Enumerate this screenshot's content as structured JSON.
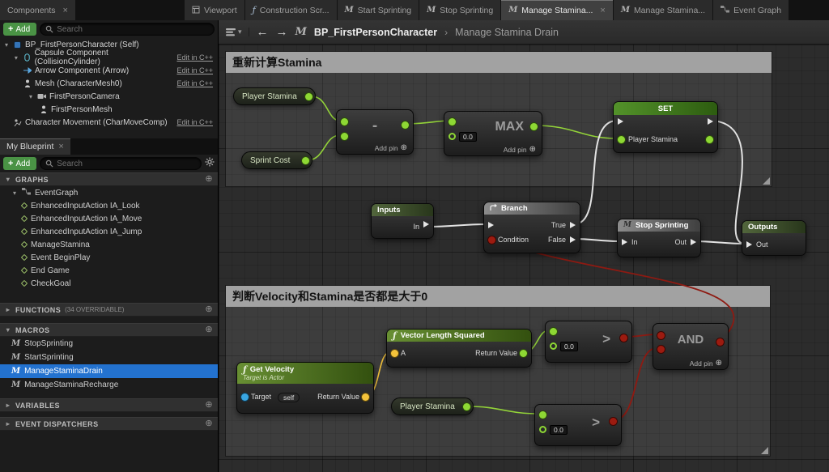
{
  "icons": {
    "close": "×",
    "plus": "+",
    "add_pin_circle": "⊕",
    "caret_down": "▾",
    "caret_right": "▸",
    "back": "←",
    "forward": "→",
    "crumb_sep": "›",
    "dropdown": "▾",
    "macro": "M",
    "function": "ƒ"
  },
  "tab_bar": {
    "components_tab": "Components",
    "tabs": [
      {
        "label": "Viewport"
      },
      {
        "label": "Construction Scr..."
      },
      {
        "label": "Start Sprinting"
      },
      {
        "label": "Stop Sprinting"
      },
      {
        "label": "Manage Stamina..."
      },
      {
        "label": "Manage Stamina..."
      },
      {
        "label": "Event Graph"
      }
    ]
  },
  "toolbar": {
    "breadcrumb_root": "BP_FirstPersonCharacter",
    "breadcrumb_current": "Manage Stamina Drain"
  },
  "components_panel": {
    "add_button": "Add",
    "search_placeholder": "Search",
    "rows": [
      {
        "label": "BP_FirstPersonCharacter (Self)"
      },
      {
        "label": "Capsule Component (CollisionCylinder)",
        "edit": "Edit in C++"
      },
      {
        "label": "Arrow Component (Arrow)",
        "edit": "Edit in C++"
      },
      {
        "label": "Mesh (CharacterMesh0)",
        "edit": "Edit in C++"
      },
      {
        "label": "FirstPersonCamera"
      },
      {
        "label": "FirstPersonMesh"
      },
      {
        "label": "Character Movement (CharMoveComp)",
        "edit": "Edit in C++"
      }
    ]
  },
  "my_blueprint": {
    "title": "My Blueprint",
    "add_button": "Add",
    "search_placeholder": "Search",
    "graphs_header": "GRAPHS",
    "event_graph": "EventGraph",
    "graph_items": [
      "EnhancedInputAction IA_Look",
      "EnhancedInputAction IA_Move",
      "EnhancedInputAction IA_Jump",
      "ManageStamina",
      "Event BeginPlay",
      "End Game",
      "CheckGoal"
    ],
    "functions_header": "FUNCTIONS",
    "functions_note": "(34 OVERRIDABLE)",
    "macros_header": "MACROS",
    "macro_items": [
      {
        "label": "StopSprinting"
      },
      {
        "label": "StartSprinting"
      },
      {
        "label": "ManageStaminaDrain"
      },
      {
        "label": "ManageStaminaRecharge"
      }
    ],
    "variables_header": "VARIABLES",
    "event_dispatchers_header": "EVENT DISPATCHERS"
  },
  "graph": {
    "comment1": "重新计算Stamina",
    "comment2": "判断Velocity和Stamina是否都是大于0",
    "nodes": {
      "player_stamina_a": "Player Stamina",
      "sprint_cost": "Sprint Cost",
      "subtract": {
        "symbol": "-",
        "add_pin": "Add pin"
      },
      "max": {
        "title": "MAX",
        "literal": "0.0",
        "add_pin": "Add pin"
      },
      "set": {
        "header": "SET",
        "var_name": "Player Stamina"
      },
      "inputs": {
        "title": "Inputs",
        "out_pin": "In"
      },
      "branch": {
        "title": "Branch",
        "condition": "Condition",
        "true_pin": "True",
        "false_pin": "False"
      },
      "stop_sprinting": {
        "title": "Stop Sprinting",
        "in_pin": "In",
        "out_pin": "Out"
      },
      "outputs": {
        "title": "Outputs",
        "in_pin": "Out"
      },
      "get_velocity": {
        "title": "Get Velocity",
        "subtitle": "Target is Actor",
        "target_label": "Target",
        "target_value": "self",
        "return_label": "Return Value"
      },
      "vector_length_squared": {
        "title": "Vector Length Squared",
        "a_label": "A",
        "return_label": "Return Value"
      },
      "greater_a": {
        "symbol": ">",
        "literal": "0.0"
      },
      "player_stamina_b": "Player Stamina",
      "greater_b": {
        "symbol": ">",
        "literal": "0.0"
      },
      "and": {
        "title": "AND",
        "add_pin": "Add pin"
      }
    }
  }
}
